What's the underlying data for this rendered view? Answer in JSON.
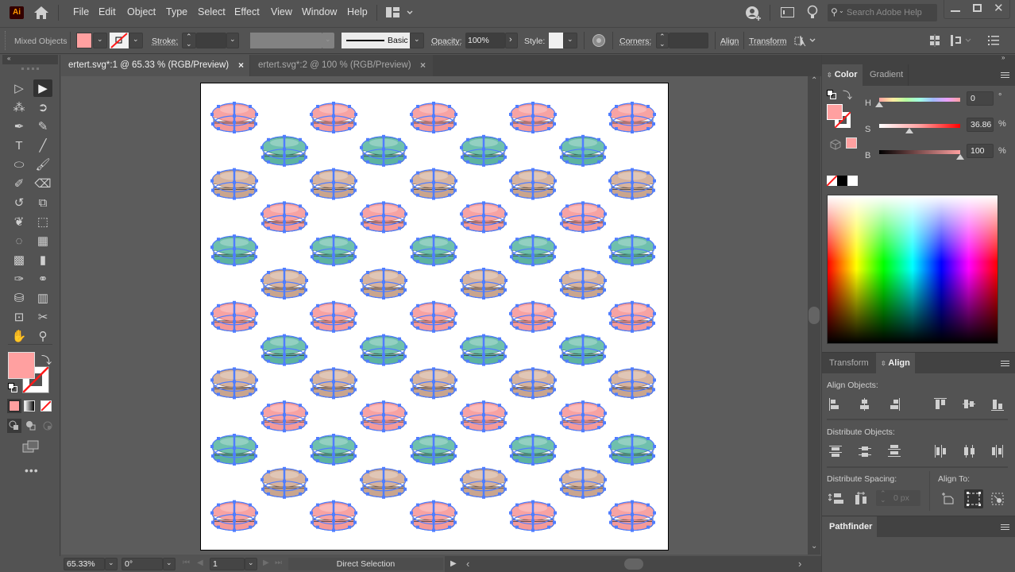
{
  "app": {
    "logo_label": "Ai"
  },
  "menubar": {
    "items": [
      "File",
      "Edit",
      "Object",
      "Type",
      "Select",
      "Effect",
      "View",
      "Window",
      "Help"
    ],
    "search_placeholder": "Search Adobe Help"
  },
  "control_bar": {
    "selection_label": "Mixed Objects",
    "fill_color": "#ffa0a0",
    "stroke_label": "Stroke:",
    "stroke_value": "",
    "brush_label": "Basic",
    "opacity_label": "Opacity:",
    "opacity_value": "100%",
    "style_label": "Style:",
    "corners_label": "Corners:",
    "corners_value": "",
    "align_label": "Align",
    "transform_label": "Transform"
  },
  "doc_tabs": [
    {
      "label": "ertert.svg*:1 @ 65.33 % (RGB/Preview)",
      "active": true
    },
    {
      "label": "ertert.svg*:2 @ 100 % (RGB/Preview)",
      "active": false
    }
  ],
  "toolbar": {
    "fill_color": "#ffa0a0",
    "tools": [
      {
        "name": "selection-tool-icon",
        "glyph": "▷"
      },
      {
        "name": "direct-selection-tool-icon",
        "glyph": "▶",
        "selected": true
      },
      {
        "name": "magic-wand-tool-icon",
        "glyph": "⁂"
      },
      {
        "name": "lasso-tool-icon",
        "glyph": "➲"
      },
      {
        "name": "pen-tool-icon",
        "glyph": "✒"
      },
      {
        "name": "curvature-tool-icon",
        "glyph": "✎"
      },
      {
        "name": "type-tool-icon",
        "glyph": "T"
      },
      {
        "name": "line-tool-icon",
        "glyph": "╱"
      },
      {
        "name": "ellipse-tool-icon",
        "glyph": "⬭"
      },
      {
        "name": "paintbrush-tool-icon",
        "glyph": "🖌"
      },
      {
        "name": "shaper-tool-icon",
        "glyph": "✐"
      },
      {
        "name": "eraser-tool-icon",
        "glyph": "⌫"
      },
      {
        "name": "rotate-tool-icon",
        "glyph": "↺"
      },
      {
        "name": "scale-tool-icon",
        "glyph": "⧉"
      },
      {
        "name": "warp-tool-icon",
        "glyph": "❦"
      },
      {
        "name": "free-transform-tool-icon",
        "glyph": "⬚"
      },
      {
        "name": "shape-builder-tool-icon",
        "glyph": "◌"
      },
      {
        "name": "perspective-grid-tool-icon",
        "glyph": "▦"
      },
      {
        "name": "mesh-tool-icon",
        "glyph": "▩"
      },
      {
        "name": "gradient-tool-icon",
        "glyph": "▮"
      },
      {
        "name": "eyedropper-tool-icon",
        "glyph": "✑"
      },
      {
        "name": "blend-tool-icon",
        "glyph": "⚭"
      },
      {
        "name": "symbol-sprayer-tool-icon",
        "glyph": "⛁"
      },
      {
        "name": "column-graph-tool-icon",
        "glyph": "▥"
      },
      {
        "name": "artboard-tool-icon",
        "glyph": "⊡"
      },
      {
        "name": "slice-tool-icon",
        "glyph": "✂"
      },
      {
        "name": "hand-tool-icon",
        "glyph": "✋"
      },
      {
        "name": "zoom-tool-icon",
        "glyph": "⚲"
      }
    ]
  },
  "color_panel": {
    "tabs": [
      "Color",
      "Gradient"
    ],
    "h_label": "H",
    "h_value": "0",
    "h_unit": "°",
    "s_label": "S",
    "s_value": "36.86",
    "s_unit": "%",
    "b_label": "B",
    "b_value": "100",
    "b_unit": "%",
    "h_fraction": 0.0,
    "s_fraction": 0.3686,
    "b_fraction": 1.0,
    "fill_color": "#ffa0a0"
  },
  "align_panel": {
    "tabs": [
      "Transform",
      "Align"
    ],
    "align_objects_label": "Align Objects:",
    "distribute_objects_label": "Distribute Objects:",
    "distribute_spacing_label": "Distribute Spacing:",
    "spacing_value": "0 px",
    "align_to_label": "Align To:"
  },
  "pathfinder_panel": {
    "title": "Pathfinder"
  },
  "statusbar": {
    "zoom": "65.33%",
    "rotation": "0°",
    "artboard": "1",
    "tool_name": "Direct Selection"
  },
  "artwork": {
    "rows": [
      {
        "flavor": "pink",
        "count": 5
      },
      {
        "flavor": "green",
        "count": 4
      },
      {
        "flavor": "tan",
        "count": 5
      },
      {
        "flavor": "pink",
        "count": 4
      },
      {
        "flavor": "green",
        "count": 5
      },
      {
        "flavor": "tan",
        "count": 4
      },
      {
        "flavor": "pink",
        "count": 5
      },
      {
        "flavor": "green",
        "count": 4
      },
      {
        "flavor": "tan",
        "count": 5
      },
      {
        "flavor": "pink",
        "count": 4
      },
      {
        "flavor": "green",
        "count": 5
      },
      {
        "flavor": "tan",
        "count": 4
      },
      {
        "flavor": "pink",
        "count": 5
      }
    ],
    "colors": {
      "pink": {
        "top": "#f7a3a3",
        "bottom": "#f49a9a",
        "edge": "#d77a7a"
      },
      "green": {
        "top": "#6fc0ad",
        "bottom": "#5db3a0",
        "edge": "#3f8f7e"
      },
      "tan": {
        "top": "#d6b39e",
        "bottom": "#c9a58e",
        "edge": "#9a7a66"
      }
    },
    "selection_color": "#4f7dff"
  }
}
